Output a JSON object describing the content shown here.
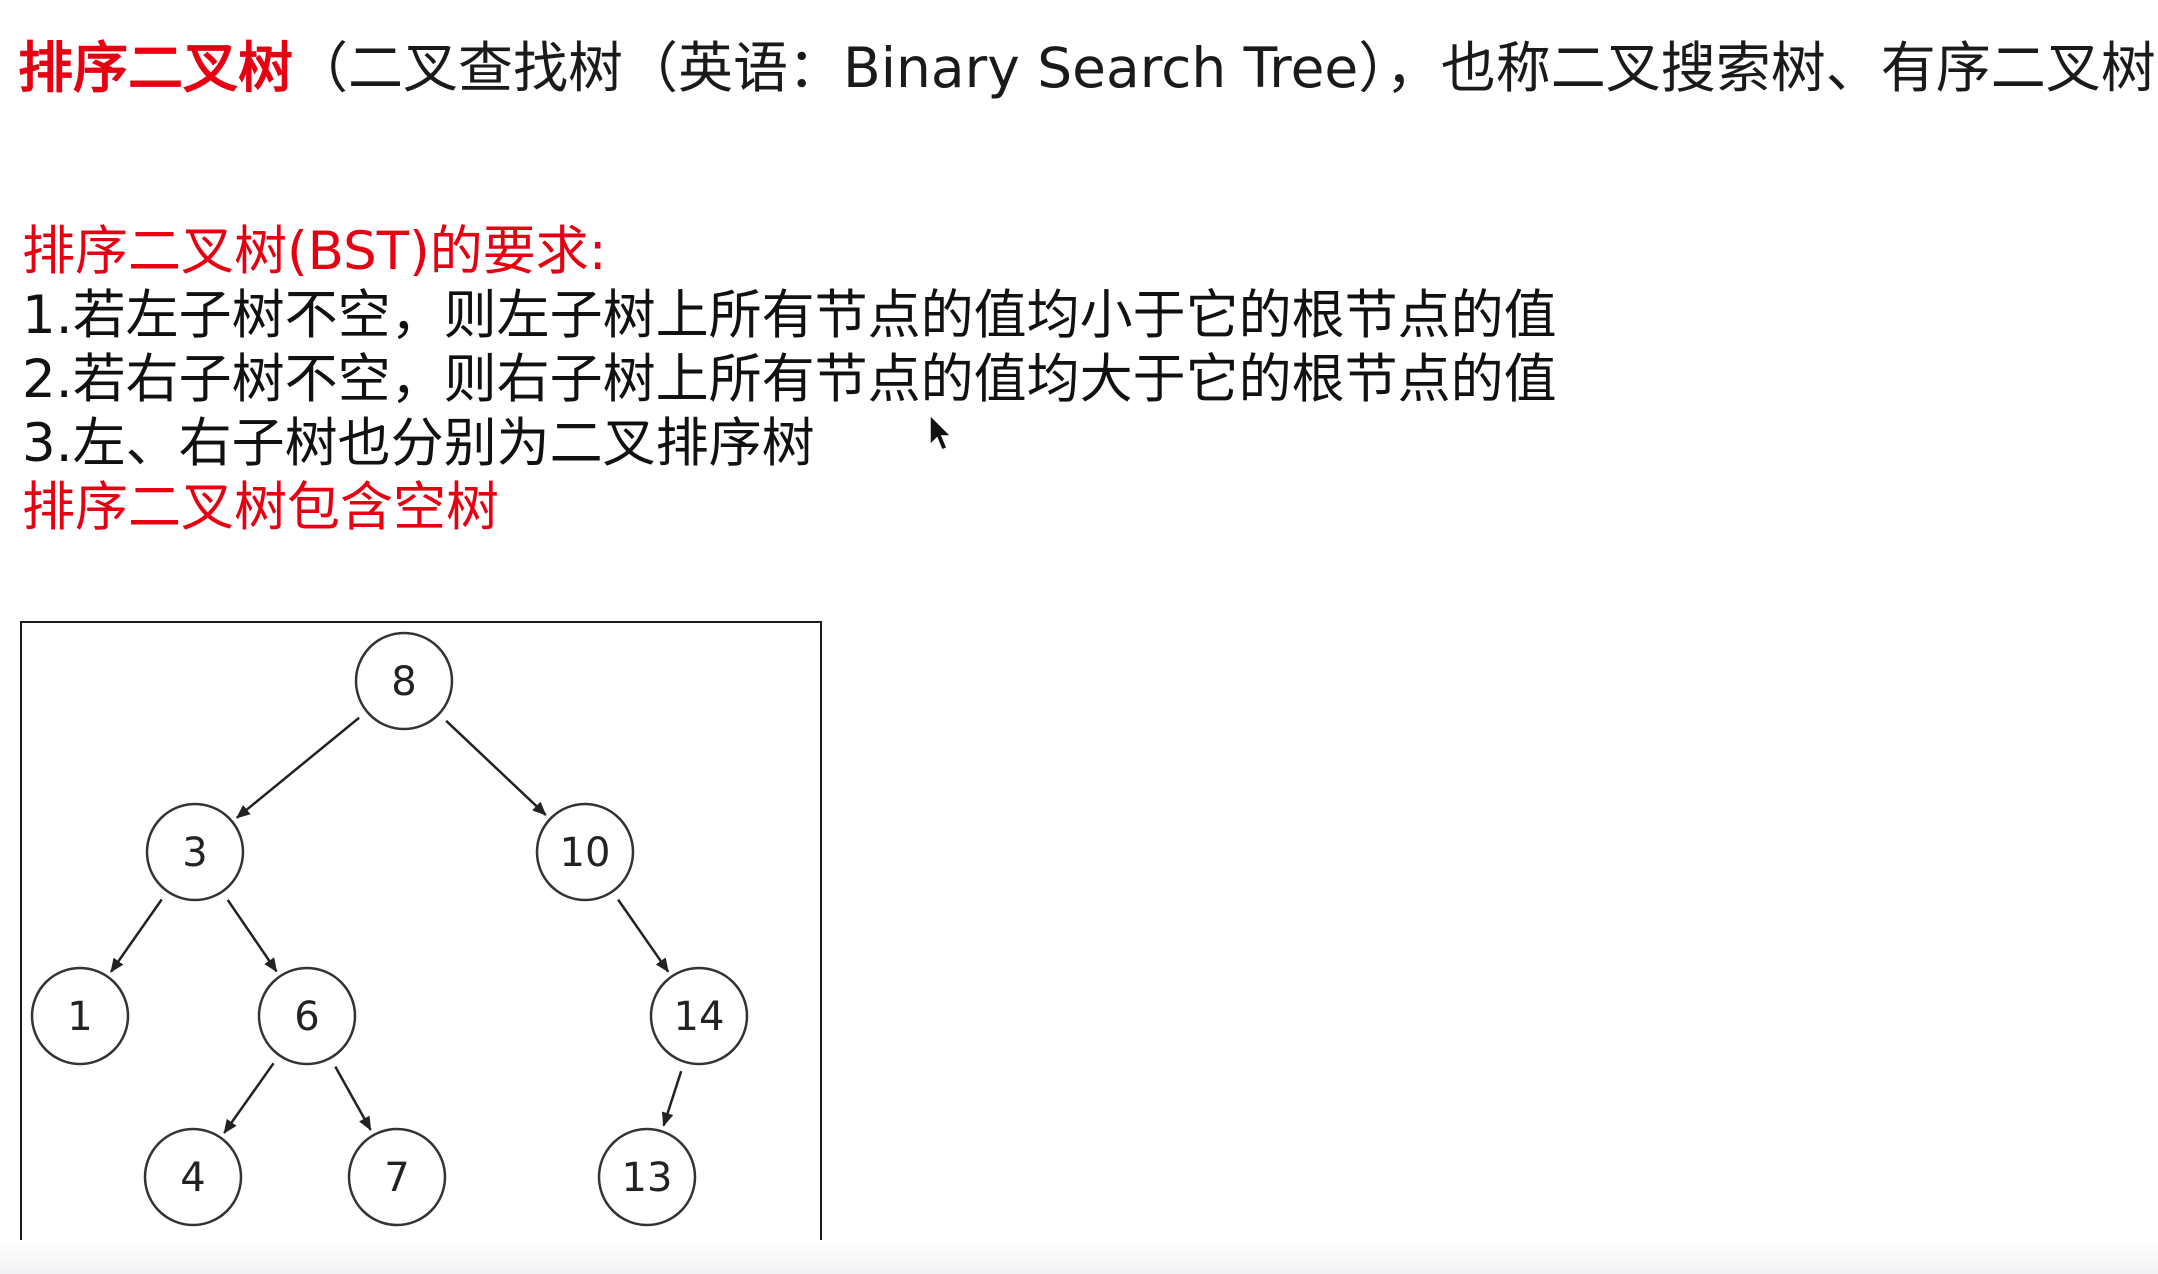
{
  "title": {
    "strong": "排序二叉树",
    "rest": "（二叉查找树（英语：Binary Search Tree），也称二叉搜索树、有序二叉树）"
  },
  "requirements": {
    "heading": "排序二叉树(BST)的要求:",
    "rules": [
      "1.若左子树不空，则左子树上所有节点的值均小于它的根节点的值",
      "2.若右子树不空，则右子树上所有节点的值均大于它的根节点的值",
      "3.左、右子树也分别为二叉排序树"
    ],
    "note": "排序二叉树包含空树"
  },
  "tree": {
    "nodes": [
      {
        "id": "n8",
        "label": "8"
      },
      {
        "id": "n3",
        "label": "3"
      },
      {
        "id": "n10",
        "label": "10"
      },
      {
        "id": "n1",
        "label": "1"
      },
      {
        "id": "n6",
        "label": "6"
      },
      {
        "id": "n14",
        "label": "14"
      },
      {
        "id": "n4",
        "label": "4"
      },
      {
        "id": "n7",
        "label": "7"
      },
      {
        "id": "n13",
        "label": "13"
      }
    ],
    "edges": [
      [
        "n8",
        "n3"
      ],
      [
        "n8",
        "n10"
      ],
      [
        "n3",
        "n1"
      ],
      [
        "n3",
        "n6"
      ],
      [
        "n10",
        "n14"
      ],
      [
        "n6",
        "n4"
      ],
      [
        "n6",
        "n7"
      ],
      [
        "n14",
        "n13"
      ]
    ]
  },
  "colors": {
    "accent_red": "#e60012",
    "text": "#1a1a1a"
  },
  "icons": {
    "cursor": "mouse-pointer-icon"
  }
}
